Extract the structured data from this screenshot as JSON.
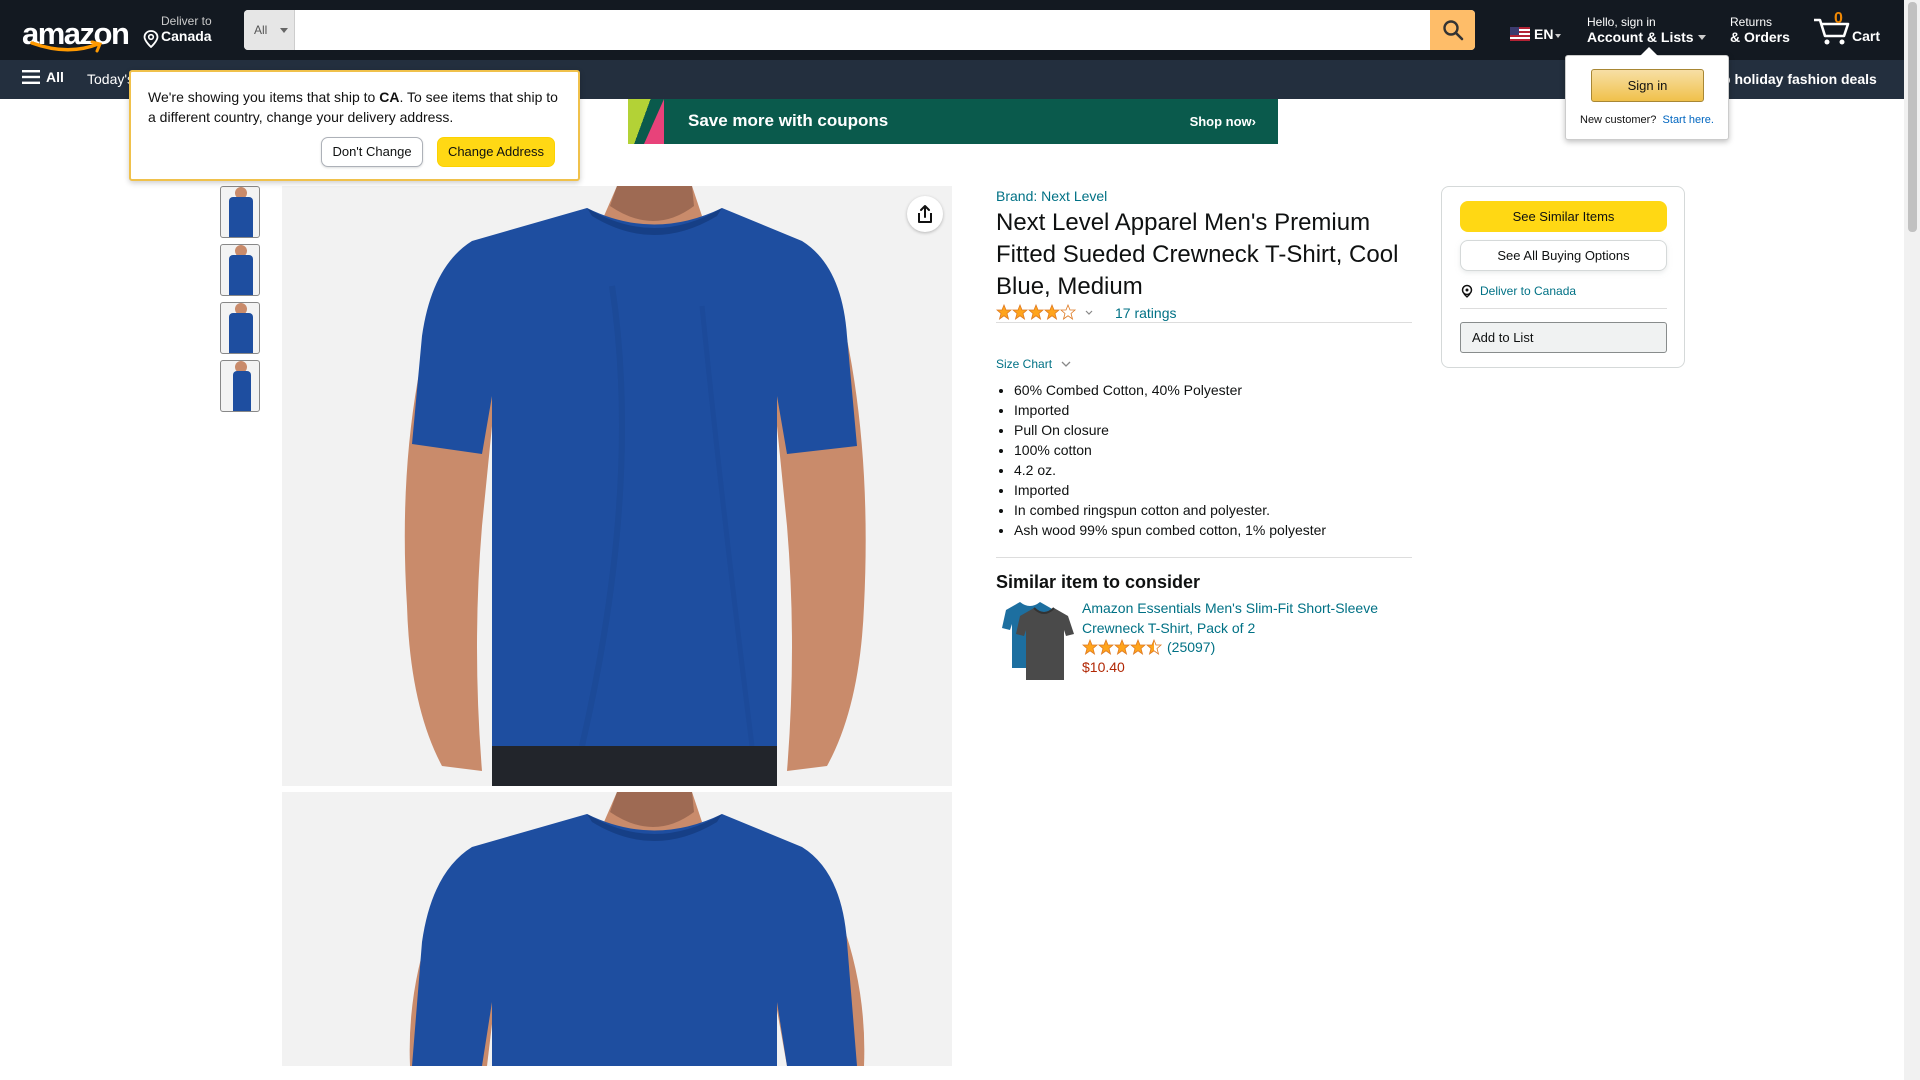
{
  "header": {
    "logo_text": "amazon",
    "deliver_line1": "Deliver to",
    "deliver_line2": "Canada",
    "search_category": "All",
    "search_placeholder": "",
    "lang": "EN",
    "account_line1": "Hello, sign in",
    "account_line2": "Account & Lists",
    "orders_line1": "Returns",
    "orders_line2": "& Orders",
    "cart_count": "0",
    "cart_label": "Cart"
  },
  "subnav": {
    "all_label": "All",
    "todays_label": "Today's",
    "promo_label": "o holiday fashion deals"
  },
  "ship_popover": {
    "message_pre": "We're showing you items that ship to ",
    "country": "CA",
    "message_post": ". To see items that ship to a different country, change your delivery address.",
    "dont_change_label": "Don't Change",
    "change_address_label": "Change Address"
  },
  "signin_popover": {
    "signin_label": "Sign in",
    "new_customer_text": "New customer?",
    "start_here_label": "Start here."
  },
  "banner": {
    "text": "Save more with coupons",
    "cta": "Shop now›"
  },
  "product": {
    "brand": "Brand: Next Level",
    "title": "Next Level Apparel Men's Premium Fitted Sueded Crewneck T-Shirt, Cool Blue, Medium",
    "rating_stars": 4.0,
    "ratings_label": "17 ratings",
    "size_chart_label": "Size Chart",
    "bullets": [
      "60% Combed Cotton, 40% Polyester",
      "Imported",
      "Pull On closure",
      "100% cotton",
      "4.2 oz.",
      "Imported",
      "In combed ringspun cotton and polyester.",
      "Ash wood 99% spun combed cotton, 1% polyester"
    ],
    "shirt_color": "#1e4ea0"
  },
  "similar": {
    "heading": "Similar item to consider",
    "title": "Amazon Essentials Men's Slim-Fit Short-Sleeve Crewneck T-Shirt, Pack of 2",
    "rating_stars": 4.5,
    "rating_count": "(25097)",
    "price": "$10.40"
  },
  "buybox": {
    "see_similar_label": "See Similar Items",
    "see_buying_label": "See All Buying Options",
    "deliver_label": "Deliver to Canada",
    "add_list_label": "Add to List"
  },
  "colors": {
    "nav_bg": "#131921",
    "subnav_bg": "#232f3e",
    "link": "#007185",
    "yellow_button": "#ffd814",
    "price": "#b12704",
    "star": "#ffa41c"
  }
}
